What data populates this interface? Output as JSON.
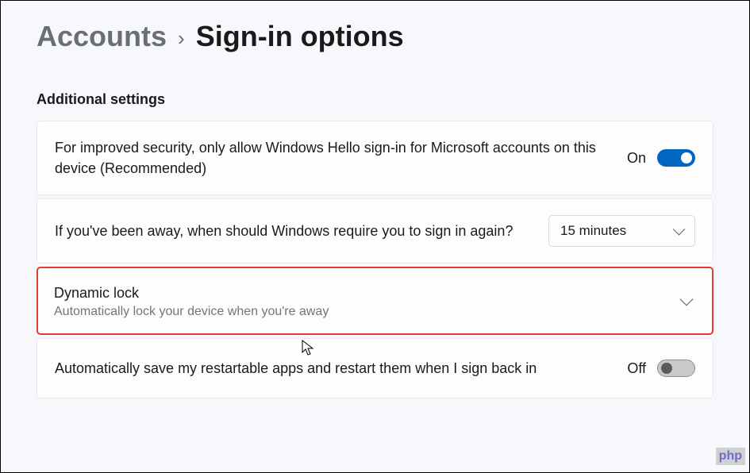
{
  "breadcrumb": {
    "parent": "Accounts",
    "current": "Sign-in options"
  },
  "section": {
    "heading": "Additional settings"
  },
  "settings": {
    "hello": {
      "title": "For improved security, only allow Windows Hello sign-in for Microsoft accounts on this device (Recommended)",
      "toggle_label": "On"
    },
    "require_signin": {
      "title": "If you've been away, when should Windows require you to sign in again?",
      "dropdown_value": "15 minutes"
    },
    "dynamic_lock": {
      "title": "Dynamic lock",
      "subtitle": "Automatically lock your device when you're away"
    },
    "restartable": {
      "title": "Automatically save my restartable apps and restart them when I sign back in",
      "toggle_label": "Off"
    }
  },
  "watermark": {
    "prefix": "php",
    "suffix": ""
  }
}
